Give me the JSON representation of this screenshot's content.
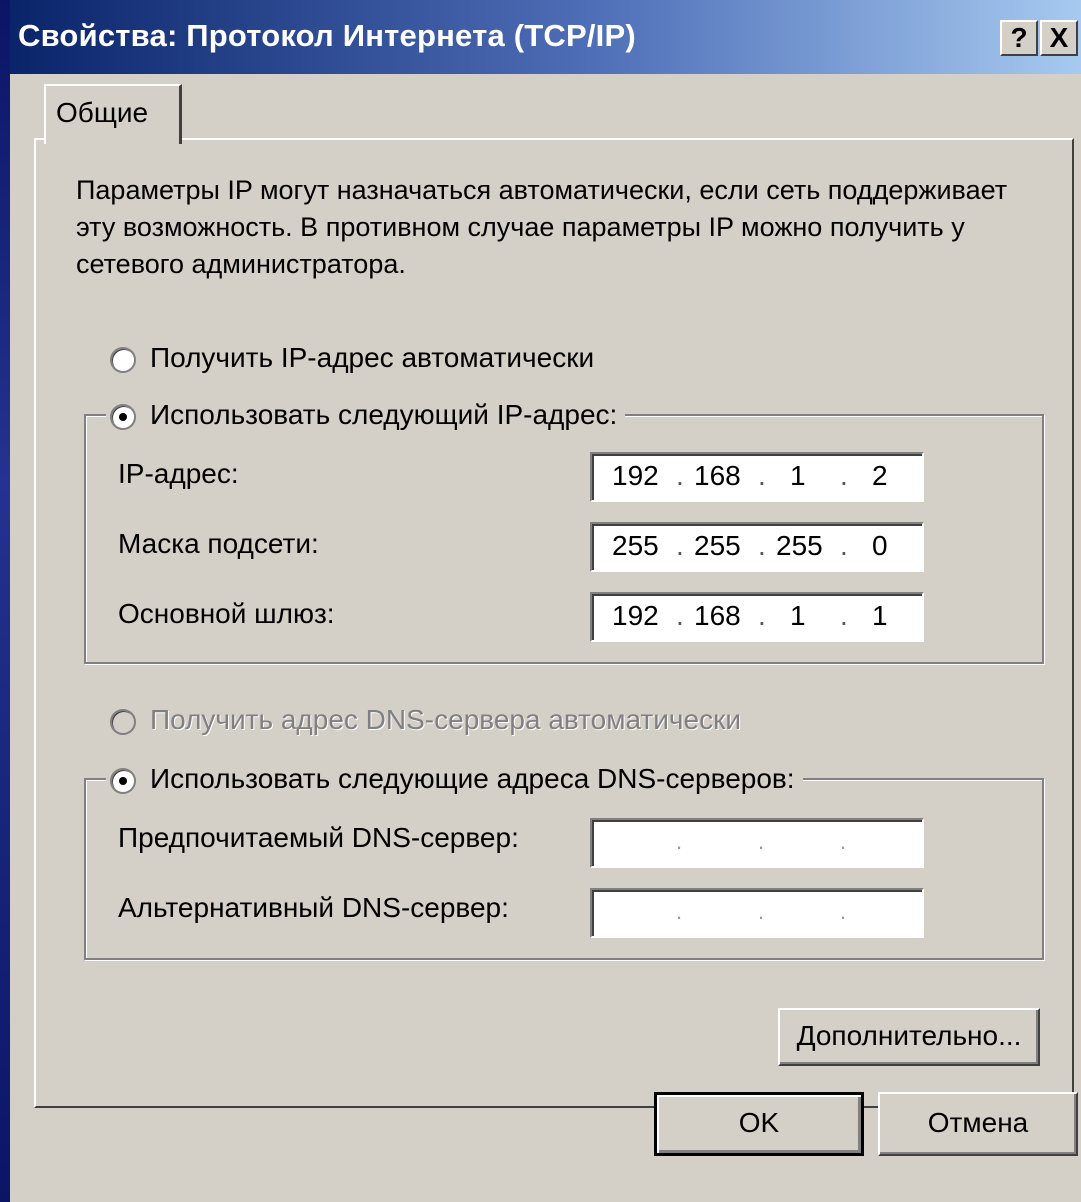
{
  "window": {
    "title": "Свойства: Протокол Интернета (TCP/IP)",
    "help_label": "?",
    "close_label": "X"
  },
  "tabs": [
    {
      "label": "Общие"
    }
  ],
  "description": "Параметры IP могут назначаться автоматически, если сеть поддерживает эту возможность. В противном случае параметры IP можно получить у сетевого администратора.",
  "ip_mode": {
    "auto_label": "Получить IP-адрес автоматически",
    "manual_label": "Использовать следующий IP-адрес:",
    "selected": "manual"
  },
  "ip_fields": [
    {
      "label": "IP-адрес:",
      "octets": [
        "192",
        "168",
        "1",
        "2"
      ]
    },
    {
      "label": "Маска подсети:",
      "octets": [
        "255",
        "255",
        "255",
        "0"
      ]
    },
    {
      "label": "Основной шлюз:",
      "octets": [
        "192",
        "168",
        "1",
        "1"
      ]
    }
  ],
  "dns_mode": {
    "auto_label": "Получить адрес DNS-сервера автоматически",
    "auto_disabled": true,
    "manual_label": "Использовать следующие адреса DNS-серверов:",
    "selected": "manual"
  },
  "dns_fields": [
    {
      "label": "Предпочитаемый DNS-сервер:",
      "octets": [
        "",
        "",
        "",
        ""
      ]
    },
    {
      "label": "Альтернативный DNS-сервер:",
      "octets": [
        "",
        "",
        "",
        ""
      ]
    }
  ],
  "buttons": {
    "advanced": "Дополнительно...",
    "ok": "OK",
    "cancel": "Отмена"
  },
  "colors": {
    "title_gradient_start": "#0a246a",
    "title_gradient_end": "#a6caf0",
    "face": "#d4d0c8"
  }
}
